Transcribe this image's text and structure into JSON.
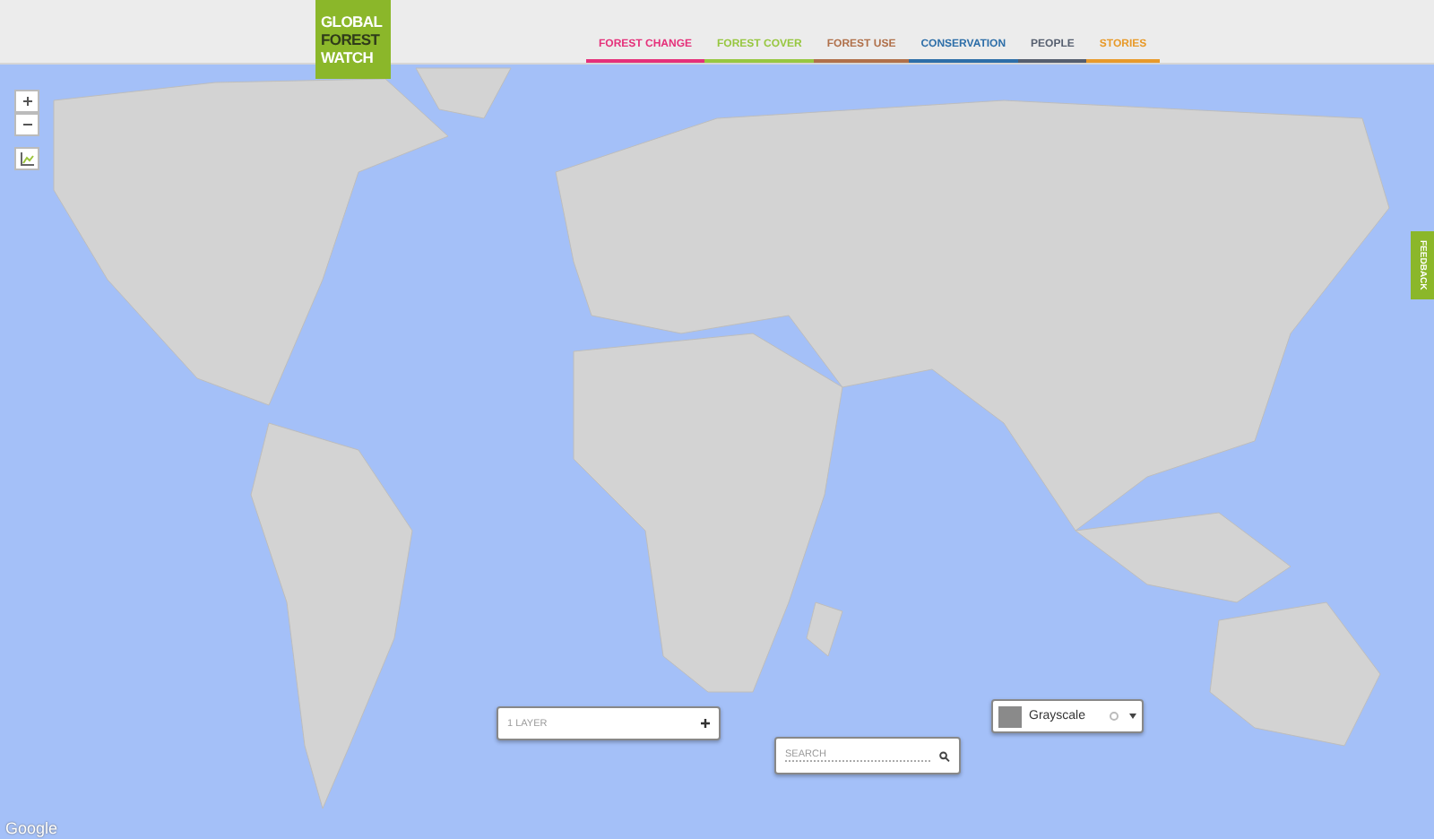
{
  "logo": {
    "lines": [
      "GLOBAL",
      "FOREST",
      "WATCH"
    ]
  },
  "nav": [
    {
      "label": "FOREST CHANGE",
      "color": "#e5307a"
    },
    {
      "label": "FOREST COVER",
      "color": "#97c740"
    },
    {
      "label": "FOREST USE",
      "color": "#b0704a"
    },
    {
      "label": "CONSERVATION",
      "color": "#2d6ea8"
    },
    {
      "label": "PEOPLE",
      "color": "#555e6e"
    },
    {
      "label": "STORIES",
      "color": "#e89a2a"
    }
  ],
  "layers": {
    "label": "1 LAYER"
  },
  "search": {
    "placeholder": "SEARCH"
  },
  "basemap": {
    "label": "Grayscale"
  },
  "feedback": {
    "label": "FEEDBACK"
  },
  "map": {
    "attribution": "Google"
  }
}
